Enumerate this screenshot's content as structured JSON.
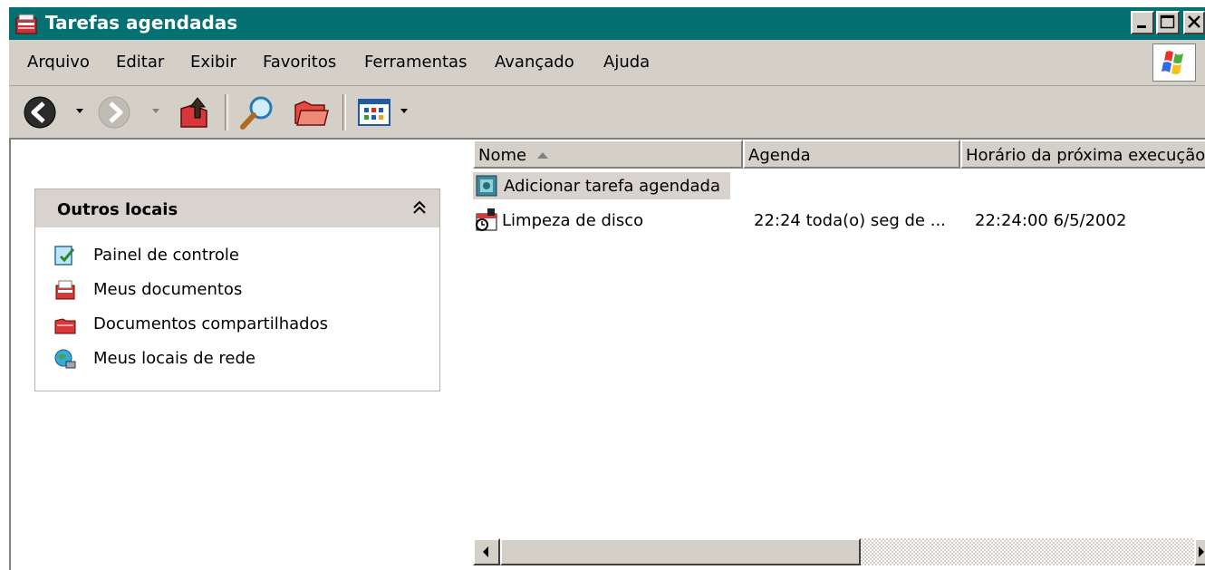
{
  "window": {
    "title": "Tarefas agendadas",
    "icon": "scheduled-tasks-icon",
    "controls": [
      "minimize",
      "maximize",
      "close"
    ]
  },
  "menu": {
    "items": [
      "Arquivo",
      "Editar",
      "Exibir",
      "Favoritos",
      "Ferramentas",
      "Avançado",
      "Ajuda"
    ]
  },
  "toolbar": {
    "buttons": [
      "back-icon",
      "forward-icon",
      "up-folder-icon",
      "search-icon",
      "folders-icon",
      "views-icon"
    ]
  },
  "sidebar": {
    "panel_title": "Outros locais",
    "links": [
      {
        "label": "Painel de controle",
        "icon": "control-panel-icon"
      },
      {
        "label": "Meus documentos",
        "icon": "my-documents-icon"
      },
      {
        "label": "Documentos compartilhados",
        "icon": "shared-documents-icon"
      },
      {
        "label": "Meus locais de rede",
        "icon": "network-places-icon"
      }
    ]
  },
  "list": {
    "columns": [
      "Nome",
      "Agenda",
      "Horário da próxima execução"
    ],
    "sort_column": "Nome",
    "rows": [
      {
        "name": "Adicionar tarefa agendada",
        "schedule": "",
        "next_run": "",
        "icon": "add-task-icon",
        "selected": true
      },
      {
        "name": "Limpeza de disco",
        "schedule": "22:24 toda(o) seg de ...",
        "next_run": "22:24:00  6/5/2002",
        "icon": "task-icon",
        "selected": false
      }
    ]
  },
  "colors": {
    "title_bar": "#047071",
    "chrome": "#d4d0c8",
    "panel_header": "#d8d3cf",
    "selection": "#d8d3cf"
  }
}
